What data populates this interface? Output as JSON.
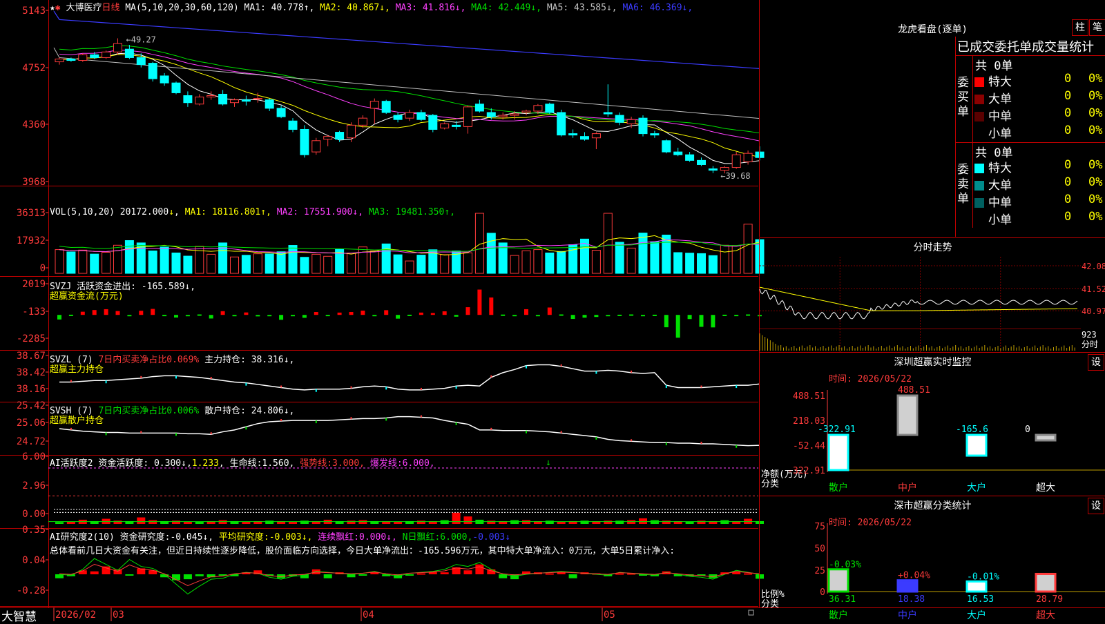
{
  "chart_data": [
    {
      "type": "candlestick",
      "title": "大博医疗",
      "period": "日线",
      "ma_label": "MA(5,10,20,30,60,120)",
      "ma_values": [
        {
          "name": "MA1",
          "value": "40.778",
          "arrow": "↑",
          "color": "#ffffff"
        },
        {
          "name": "MA2",
          "value": "40.867",
          "arrow": "↓",
          "color": "#ffff00"
        },
        {
          "name": "MA3",
          "value": "41.816",
          "arrow": "↓",
          "color": "#ff40ff"
        },
        {
          "name": "MA4",
          "value": "42.449",
          "arrow": "↓",
          "color": "#00e000"
        },
        {
          "name": "MA5",
          "value": "43.585",
          "arrow": "↓",
          "color": "#c0c0c0"
        },
        {
          "name": "MA6",
          "value": "46.369",
          "arrow": "↓",
          "color": "#3b3bff"
        }
      ],
      "y_ticks": [
        "5143",
        "4752",
        "4360",
        "3968"
      ],
      "ylim": [
        39.0,
        51.5
      ],
      "high_label": "49.27",
      "low_label": "39.68",
      "x_ticks": [
        "2026/02",
        "03",
        "04",
        "05"
      ],
      "ohlc": [
        [
          47.6,
          47.9,
          47.4,
          47.8
        ],
        [
          47.8,
          47.9,
          47.6,
          47.7
        ],
        [
          47.7,
          48.2,
          47.6,
          48.1
        ],
        [
          48.1,
          48.3,
          47.8,
          47.9
        ],
        [
          47.9,
          48.4,
          47.8,
          48.3
        ],
        [
          48.3,
          49.27,
          48.1,
          48.9
        ],
        [
          48.5,
          48.8,
          47.8,
          47.9
        ],
        [
          47.9,
          48.2,
          47.2,
          47.4
        ],
        [
          47.5,
          47.6,
          46.2,
          46.4
        ],
        [
          46.6,
          46.8,
          45.9,
          46.1
        ],
        [
          46.1,
          46.2,
          45.3,
          45.4
        ],
        [
          45.2,
          45.5,
          44.4,
          44.7
        ],
        [
          44.6,
          45.3,
          44.5,
          45.1
        ],
        [
          45.1,
          45.5,
          44.9,
          45.2
        ],
        [
          45.3,
          45.6,
          44.5,
          44.6
        ],
        [
          44.7,
          45.0,
          44.4,
          44.9
        ],
        [
          44.9,
          45.2,
          44.5,
          44.8
        ],
        [
          45.0,
          45.4,
          44.7,
          45.0
        ],
        [
          44.9,
          45.0,
          44.1,
          44.3
        ],
        [
          44.3,
          44.5,
          43.6,
          43.7
        ],
        [
          43.4,
          43.6,
          42.6,
          42.8
        ],
        [
          42.8,
          43.1,
          40.8,
          41.0
        ],
        [
          41.2,
          42.2,
          41.0,
          42.0
        ],
        [
          42.1,
          42.4,
          41.6,
          42.3
        ],
        [
          42.6,
          42.7,
          41.9,
          42.1
        ],
        [
          42.2,
          43.3,
          41.9,
          43.1
        ],
        [
          43.1,
          43.8,
          42.9,
          43.6
        ],
        [
          44.3,
          45.0,
          43.2,
          44.8
        ],
        [
          44.8,
          44.9,
          43.9,
          44.0
        ],
        [
          43.8,
          44.0,
          43.3,
          43.5
        ],
        [
          43.6,
          44.2,
          43.4,
          44.0
        ],
        [
          44.0,
          44.2,
          43.4,
          43.5
        ],
        [
          43.8,
          43.9,
          42.6,
          42.8
        ],
        [
          42.9,
          43.3,
          42.8,
          43.2
        ],
        [
          43.1,
          43.4,
          42.8,
          43.0
        ],
        [
          43.0,
          44.5,
          42.5,
          44.4
        ],
        [
          44.6,
          44.9,
          44.0,
          44.1
        ],
        [
          44.0,
          44.3,
          43.5,
          43.7
        ],
        [
          43.7,
          44.0,
          43.5,
          43.8
        ],
        [
          43.8,
          44.1,
          43.5,
          43.9
        ],
        [
          44.0,
          44.2,
          43.8,
          44.1
        ],
        [
          44.1,
          44.6,
          43.9,
          44.5
        ],
        [
          44.6,
          44.7,
          43.9,
          44.0
        ],
        [
          44.0,
          44.2,
          42.3,
          42.4
        ],
        [
          42.5,
          42.8,
          42.2,
          42.4
        ],
        [
          42.3,
          42.6,
          42.0,
          42.1
        ],
        [
          42.2,
          42.6,
          41.4,
          42.5
        ],
        [
          44.0,
          46.0,
          43.7,
          43.9
        ],
        [
          43.8,
          44.0,
          43.1,
          43.3
        ],
        [
          43.2,
          43.7,
          42.9,
          43.5
        ],
        [
          43.6,
          43.8,
          42.3,
          42.5
        ],
        [
          42.5,
          42.7,
          42.2,
          42.4
        ],
        [
          42.0,
          42.1,
          41.1,
          41.2
        ],
        [
          41.2,
          41.5,
          40.9,
          41.0
        ],
        [
          41.0,
          41.2,
          40.5,
          40.6
        ],
        [
          40.6,
          40.8,
          40.2,
          40.3
        ],
        [
          40.0,
          40.2,
          39.7,
          39.9
        ],
        [
          39.9,
          40.2,
          39.68,
          40.1
        ],
        [
          40.1,
          41.2,
          40.0,
          41.0
        ],
        [
          40.5,
          41.3,
          40.3,
          41.1
        ],
        [
          41.2,
          41.6,
          40.6,
          40.8
        ]
      ]
    },
    {
      "type": "bar",
      "name": "VOL",
      "label": "VOL(5,10,20)",
      "value": "20172.000",
      "ma_values": [
        {
          "name": "MA1",
          "value": "18116.801",
          "arrow": "↑",
          "color": "#ffff00"
        },
        {
          "name": "MA2",
          "value": "17551.900",
          "arrow": "↓",
          "color": "#ff40ff"
        },
        {
          "name": "MA3",
          "value": "19481.350",
          "arrow": "↑",
          "color": "#00e000"
        }
      ],
      "y_ticks": [
        "36313",
        "17932",
        "0"
      ],
      "ylim": [
        0,
        36313
      ],
      "values": [
        14200,
        12800,
        13900,
        11500,
        12600,
        16800,
        19600,
        18200,
        13400,
        15700,
        12200,
        10300,
        16200,
        11400,
        18200,
        9800,
        10800,
        11700,
        11600,
        12900,
        16700,
        9600,
        11400,
        10200,
        14300,
        12100,
        15800,
        13400,
        17600,
        11100,
        7400,
        10900,
        14100,
        11200,
        13400,
        12300,
        35900,
        24000,
        18200,
        10700,
        13500,
        14200,
        12200,
        13100,
        17100,
        20500,
        13800,
        35900,
        18600,
        15100,
        24100,
        18900,
        22900,
        12400,
        12100,
        11800,
        10600,
        16800,
        16600,
        29400,
        20172
      ],
      "up": [
        1,
        0,
        1,
        0,
        1,
        1,
        0,
        0,
        0,
        0,
        0,
        0,
        1,
        1,
        0,
        1,
        0,
        1,
        0,
        0,
        0,
        0,
        1,
        1,
        0,
        1,
        1,
        1,
        0,
        0,
        1,
        0,
        0,
        1,
        0,
        1,
        1,
        0,
        0,
        1,
        1,
        1,
        0,
        0,
        0,
        0,
        1,
        1,
        0,
        1,
        0,
        0,
        0,
        0,
        0,
        0,
        0,
        1,
        1,
        1,
        0
      ]
    },
    {
      "type": "bar",
      "name": "SVZJ",
      "label": "SVZJ  活跃资金进出:",
      "value": "-165.589",
      "arrow": "↓",
      "sublabel": "超赢资金流(万元)",
      "y_ticks": [
        "2019",
        "-133",
        "-2285"
      ],
      "ylim": [
        -2285,
        2019
      ],
      "values": [
        -420,
        -80,
        130,
        250,
        310,
        180,
        -110,
        200,
        330,
        -90,
        -280,
        -150,
        -60,
        -350,
        170,
        -120,
        80,
        -200,
        -180,
        -440,
        -190,
        -300,
        110,
        -90,
        70,
        110,
        210,
        -160,
        240,
        -360,
        -80,
        70,
        40,
        160,
        -220,
        450,
        1700,
        1140,
        -70,
        -190,
        310,
        -110,
        430,
        -60,
        -380,
        -290,
        -240,
        -170,
        -80,
        -60,
        -180,
        -80,
        -970,
        -1710,
        -390,
        -940,
        -980,
        -80,
        -90,
        -60,
        -170
      ],
      "dashes": [
        "-94"
      ]
    },
    {
      "type": "line",
      "name": "SVZL",
      "label": "SVZL (7)",
      "stat": "7日内买卖净占比0.069%",
      "hold_label": "主力持仓:",
      "hold_value": "38.316",
      "arrow": "↓",
      "sublabel": "超赢主力持仓",
      "y_ticks": [
        "38.67",
        "38.42",
        "38.16"
      ],
      "ylim": [
        38.16,
        38.67
      ],
      "values": [
        38.34,
        38.34,
        38.35,
        38.36,
        38.36,
        38.37,
        38.38,
        38.39,
        38.41,
        38.42,
        38.42,
        38.41,
        38.4,
        38.38,
        38.36,
        38.34,
        38.33,
        38.31,
        38.29,
        38.27,
        38.25,
        38.24,
        38.25,
        38.25,
        38.25,
        38.26,
        38.28,
        38.29,
        38.28,
        38.25,
        38.24,
        38.24,
        38.25,
        38.26,
        38.29,
        38.3,
        38.29,
        38.4,
        38.46,
        38.5,
        38.55,
        38.56,
        38.56,
        38.54,
        38.51,
        38.48,
        38.48,
        38.49,
        38.48,
        38.46,
        38.45,
        38.46,
        38.3,
        38.27,
        38.27,
        38.27,
        38.28,
        38.29,
        38.3,
        38.3,
        38.316
      ]
    },
    {
      "type": "line",
      "name": "SVSH",
      "label": "SVSH (7)",
      "stat": "7日内买卖净占比0.006%",
      "hold_label": "散户持仓:",
      "hold_value": "24.806",
      "arrow": "↓",
      "sublabel": "超赢散户持仓",
      "y_ticks": [
        "25.42",
        "25.06",
        "24.72"
      ],
      "ylim": [
        24.72,
        25.42
      ],
      "values": [
        25.07,
        25.05,
        25.03,
        25.02,
        25.01,
        25.01,
        25.0,
        25.0,
        25.0,
        25.0,
        25.0,
        24.99,
        24.99,
        24.98,
        25.02,
        25.05,
        25.1,
        25.15,
        25.18,
        25.19,
        25.2,
        25.2,
        25.2,
        25.2,
        25.21,
        25.22,
        25.23,
        25.23,
        25.24,
        25.26,
        25.26,
        25.25,
        25.24,
        25.2,
        25.17,
        25.14,
        25.05,
        25.05,
        25.04,
        25.04,
        25.04,
        25.03,
        25.02,
        25.0,
        24.98,
        24.96,
        24.94,
        24.9,
        24.88,
        24.87,
        24.86,
        24.85,
        24.85,
        24.84,
        24.84,
        24.83,
        24.83,
        24.82,
        24.81,
        24.8,
        24.806
      ]
    },
    {
      "type": "bar",
      "name": "AI活跃度2",
      "label": "AI活跃度2",
      "act_label": "资金活跃度:",
      "act_value": "0.300",
      "act_arrow": "↓",
      "act2": "1.233",
      "life_label": "生命线:",
      "life_value": "1.560",
      "strong_label": "强势线:",
      "strong_value": "3.000",
      "burst_label": "爆发线:",
      "burst_value": "6.000",
      "y_ticks": [
        "6.00",
        "2.96",
        "0.00"
      ],
      "ylim": [
        0,
        6.3
      ],
      "values": [
        0.2,
        0.25,
        0.45,
        0.3,
        0.55,
        0.35,
        0.3,
        0.7,
        0.4,
        0.3,
        0.35,
        0.25,
        0.25,
        0.3,
        0.4,
        0.3,
        0.25,
        0.3,
        0.35,
        0.3,
        0.25,
        0.35,
        0.3,
        0.45,
        0.3,
        0.35,
        0.4,
        0.3,
        0.3,
        0.25,
        0.3,
        0.35,
        0.3,
        0.4,
        1.2,
        0.8,
        0.45,
        0.35,
        0.3,
        0.4,
        0.4,
        0.3,
        0.35,
        0.25,
        0.3,
        0.35,
        0.3,
        0.35,
        0.35,
        0.4,
        0.6,
        0.4,
        0.35,
        0.3,
        0.25,
        0.35,
        0.3,
        0.4,
        0.3,
        0.55,
        0.3
      ]
    },
    {
      "type": "bar",
      "name": "AI研究度2",
      "label": "AI研究度2(10)",
      "res_label": "资金研究度:",
      "res_value": "-0.045",
      "avg_label": "平均研究度:",
      "avg_value": "-0.003",
      "red_label": "连续飘红:",
      "red_value": "0.000",
      "n_label": "N日飘红:",
      "n_value": "6.000",
      "n_value2": "-0.003",
      "comment": "总体看前几日大资金有关注，但近日持续性逐步降低，股价面临方向选择，今日大单净流出：-165.596万元，其中特大单净流入：0万元，大单5日累计净入:",
      "y_ticks": [
        "0.35",
        "0.04",
        "-0.28"
      ],
      "ylim": [
        -0.28,
        0.35
      ],
      "values": [
        -0.04,
        -0.02,
        0.04,
        0.03,
        0.08,
        0.05,
        -0.01,
        0.06,
        0.04,
        -0.03,
        -0.06,
        -0.05,
        -0.02,
        -0.03,
        -0.01,
        -0.02,
        0.02,
        0.04,
        -0.01,
        -0.04,
        -0.02,
        -0.04,
        0.05,
        -0.04,
        0.02,
        -0.03,
        -0.01,
        0.02,
        -0.02,
        -0.04,
        -0.01,
        0.01,
        0.03,
        0.02,
        0.07,
        0.04,
        0.1,
        0.05,
        -0.04,
        -0.05,
        0.03,
        0.02,
        0.01,
        0.02,
        -0.04,
        0.02,
        0.01,
        -0.02,
        0.01,
        0.01,
        -0.01,
        -0.02,
        0.03,
        -0.02,
        -0.02,
        -0.01,
        -0.04,
        0.02,
        0.03,
        0.01,
        -0.045
      ],
      "line": [
        0.0,
        -0.01,
        0.05,
        0.16,
        0.1,
        0.04,
        0.15,
        0.08,
        0.06,
        0.0,
        -0.1,
        -0.2,
        -0.12,
        -0.05,
        -0.04,
        0.0,
        0.02,
        0.01,
        -0.03,
        -0.05,
        -0.02,
        -0.01,
        0.03,
        0.02,
        0.01,
        0.0,
        0.01,
        0.03,
        0.0,
        -0.02,
        0.01,
        0.02,
        0.03,
        0.05,
        0.1,
        0.08,
        0.12,
        0.05,
        0.0,
        -0.02,
        0.0,
        0.01,
        0.02,
        0.03,
        0.02,
        0.01,
        0.0,
        -0.01,
        0.02,
        0.01,
        0.0,
        -0.01,
        0.02,
        0.0,
        -0.02,
        -0.03,
        -0.05,
        0.0,
        0.04,
        0.02,
        0.0
      ]
    },
    {
      "type": "bar",
      "name": "深圳超赢实时监控",
      "title": "深圳超赢实时监控",
      "time_label": "时间: 2026/05/22",
      "y_ticks": [
        "488.51",
        "218.03",
        "-52.44",
        "-322.91"
      ],
      "ylim": [
        -322.91,
        488.51
      ],
      "categories": [
        "散户",
        "中户",
        "大户",
        "超大"
      ],
      "values": [
        -322.91,
        488.51,
        -165.6,
        0
      ],
      "value_labels": [
        "-322.91",
        "488.51",
        "-165.6",
        "0"
      ],
      "footer": [
        "净额(万元)",
        "分类"
      ]
    },
    {
      "type": "bar",
      "name": "深市超赢分类统计",
      "title": "深市超赢分类统计",
      "time_label": "时间: 2026/05/22",
      "y_ticks": [
        "75",
        "50",
        "25",
        "0"
      ],
      "ylim": [
        0,
        75
      ],
      "categories": [
        "散户",
        "中户",
        "大户",
        "超大"
      ],
      "values": [
        36.31,
        18.38,
        16.53,
        28.79
      ],
      "changes": [
        "-0.03%",
        "+0.04%",
        "-0.01%",
        ""
      ],
      "footer": [
        "比例%",
        "分类"
      ]
    },
    {
      "type": "line",
      "name": "分时走势",
      "title": "分时走势",
      "y_ticks": [
        "42.08",
        "41.52",
        "40.97"
      ],
      "ylim": [
        40.6,
        42.3
      ],
      "vol_label": "923",
      "vol_unit": "分时"
    }
  ],
  "top": {
    "stars": "★",
    "bottom_brand": "大智慧"
  },
  "lhb": {
    "title": "龙虎看盘(逐单)",
    "btn1": "柱",
    "btn2": "笔",
    "subtitle": "已成交委托单成交量统计",
    "buy": {
      "total": "共 0单",
      "side": "委买单",
      "rows": [
        {
          "label": "特大",
          "qty": "0",
          "pct": "0%",
          "color": "#ff0000"
        },
        {
          "label": "大单",
          "qty": "0",
          "pct": "0%",
          "color": "#8b0000"
        },
        {
          "label": "中单",
          "qty": "0",
          "pct": "0%",
          "color": "#5a0000"
        },
        {
          "label": "小单",
          "qty": "0",
          "pct": "0%",
          "color": "#000000"
        }
      ]
    },
    "sell": {
      "total": "共 0单",
      "side": "委卖单",
      "rows": [
        {
          "label": "特大",
          "qty": "0",
          "pct": "0%",
          "color": "#00ffff"
        },
        {
          "label": "大单",
          "qty": "0",
          "pct": "0%",
          "color": "#008b8b"
        },
        {
          "label": "中单",
          "qty": "0",
          "pct": "0%",
          "color": "#006060"
        },
        {
          "label": "小单",
          "qty": "0",
          "pct": "0%",
          "color": "#000000"
        }
      ]
    }
  },
  "set_btn": "设"
}
